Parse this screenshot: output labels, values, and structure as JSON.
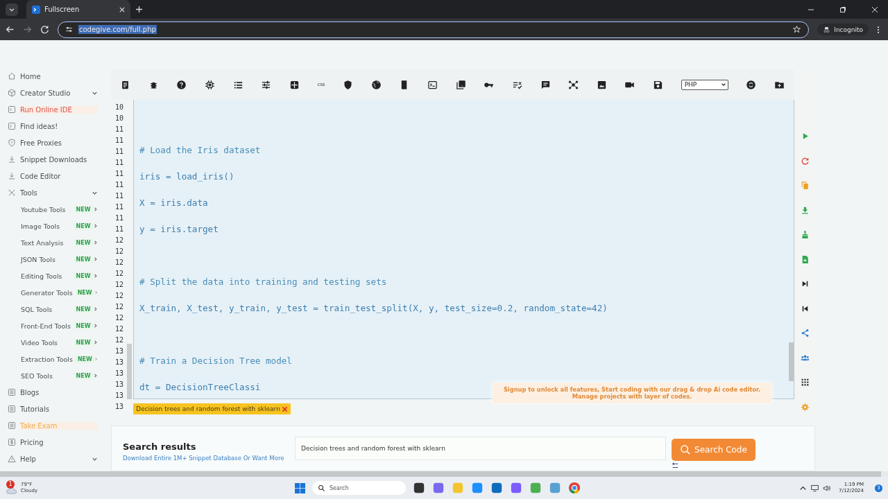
{
  "browser": {
    "tab": {
      "title": "Fullscreen"
    },
    "address": "codegive.com/full.php",
    "profile": "Incognito"
  },
  "sidebar": {
    "items": [
      {
        "label": "Home",
        "kind": "link",
        "color": "#4a4f55"
      },
      {
        "label": "Creator Studio",
        "kind": "group",
        "color": "#4a4f55"
      },
      {
        "label": "Run Online IDE",
        "kind": "link",
        "color": "#d9534f"
      },
      {
        "label": "Find ideas!",
        "kind": "link",
        "color": "#4a4f55"
      },
      {
        "label": "Free Proxies",
        "kind": "link",
        "color": "#4a4f55"
      },
      {
        "label": "Snippet Downloads",
        "kind": "link",
        "color": "#4a4f55"
      },
      {
        "label": "Code Editor",
        "kind": "link",
        "color": "#4a4f55"
      },
      {
        "label": "Tools",
        "kind": "group",
        "color": "#4a4f55",
        "children": [
          {
            "label": "Youtube Tools",
            "badge": "NEW"
          },
          {
            "label": "Image Tools",
            "badge": "NEW"
          },
          {
            "label": "Text Analysis",
            "badge": "NEW"
          },
          {
            "label": "JSON Tools",
            "badge": "NEW"
          },
          {
            "label": "Editing Tools",
            "badge": "NEW"
          },
          {
            "label": "Generator Tools",
            "badge": "NEW"
          },
          {
            "label": "SQL Tools",
            "badge": "NEW"
          },
          {
            "label": "Front-End Tools",
            "badge": "NEW"
          },
          {
            "label": "Video Tools",
            "badge": "NEW"
          },
          {
            "label": "Extraction Tools",
            "badge": "NEW"
          },
          {
            "label": "SEO Tools",
            "badge": "NEW"
          }
        ]
      },
      {
        "label": "Blogs",
        "kind": "link",
        "color": "#4a4f55"
      },
      {
        "label": "Tutorials",
        "kind": "link",
        "color": "#4a4f55"
      },
      {
        "label": "Take Exam",
        "kind": "link",
        "color": "#f0ad4e"
      },
      {
        "label": "Pricing",
        "kind": "link",
        "color": "#4a4f55"
      },
      {
        "label": "Help",
        "kind": "group",
        "color": "#4a4f55"
      }
    ]
  },
  "toolbar": {
    "css_label": "css",
    "language": "PHP"
  },
  "editor": {
    "line_numbers": [
      "10",
      "10",
      "11",
      "11",
      "11",
      "11",
      "11",
      "11",
      "11",
      "11",
      "11",
      "11",
      "12",
      "12",
      "12",
      "12",
      "12",
      "12",
      "12",
      "12",
      "12",
      "12",
      "13",
      "13",
      "13",
      "13",
      "13",
      "13"
    ],
    "blocks": [
      [
        {
          "kind": "comment",
          "text": "# Load the Iris dataset"
        },
        {
          "kind": "code",
          "text": "iris = load_iris()"
        },
        {
          "kind": "code",
          "text": "X = iris.data"
        },
        {
          "kind": "code",
          "text": "y = iris.target"
        }
      ],
      [
        {
          "kind": "comment",
          "text": "# Split the data into training and testing sets"
        },
        {
          "kind": "code",
          "text": "X_train, X_test, y_train, y_test = train_test_split(X, y, test_size=0.2, random_state=42)"
        }
      ],
      [
        {
          "kind": "comment",
          "text": "# Train a Decision Tree model"
        },
        {
          "kind": "code",
          "text": "dt = DecisionTreeClassi"
        }
      ]
    ]
  },
  "tag": "Decision trees and random forest with sklearn",
  "banner": [
    "Signup to unlock all features, Start coding with our drag & drop Ai code editor.",
    "Manage projects with layer of codes."
  ],
  "search": {
    "title": "Search results",
    "subtitle": "Download Entire 1M+ Snippet Database Or Want",
    "link": "More",
    "value": "Decision trees and random forest with sklearn",
    "button": "Search Code"
  },
  "taskbar": {
    "temperature": "79°F",
    "condition": "Cloudy",
    "weather_badge": "1",
    "search_placeholder": "Search",
    "time": "1:19 PM",
    "date": "7/12/2024",
    "notifications": "3"
  }
}
